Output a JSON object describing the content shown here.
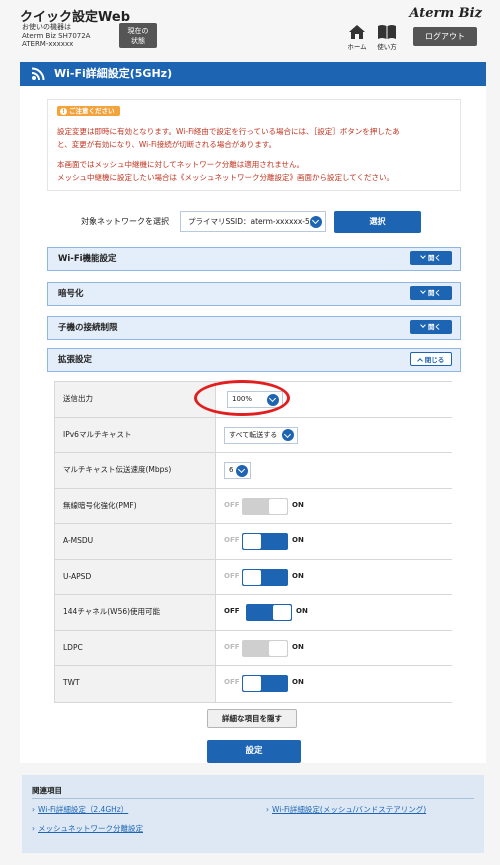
{
  "header": {
    "app_title": "クイック設定Web",
    "device_line1": "お使いの機器は",
    "device_line2": "Aterm Biz SH7072A",
    "device_line3": "ATERM-xxxxxx",
    "status_button_line1": "現在の",
    "status_button_line2": "状態",
    "home_label": "ホーム",
    "help_label": "使い方",
    "logo": "Aterm Biz",
    "logout_label": "ログアウト"
  },
  "page": {
    "title": "Wi-Fi詳細設定(5GHz)"
  },
  "notice": {
    "head": "ご注意ください",
    "line1": "設定変更は即時に有効となります。Wi-Fi経由で設定を行っている場合には、［設定］ボタンを押したあ",
    "line2": "と、変更が有効になり、Wi-Fi接続が切断される場合があります。",
    "line3": "本画面ではメッシュ中継機に対してネットワーク分離は適用されません。",
    "line4": "メッシュ中継機に設定したい場合は《メッシュネットワーク分離設定》画面から設定してください。"
  },
  "network_select": {
    "label": "対象ネットワークを選択",
    "value": "プライマリSSID：aterm-xxxxxx-5p",
    "button": "選択"
  },
  "sections": [
    {
      "title": "Wi-Fi機能設定",
      "button": "開く"
    },
    {
      "title": "暗号化",
      "button": "開く"
    },
    {
      "title": "子機の接続制限",
      "button": "開く"
    },
    {
      "title": "拡張設定",
      "button": "閉じる"
    }
  ],
  "settings": {
    "tx_power": {
      "label": "送信出力",
      "value": "100%"
    },
    "ipv6_multicast": {
      "label": "IPv6マルチキャスト",
      "value": "すべて転送する"
    },
    "multicast_rate": {
      "label": "マルチキャスト伝送速度(Mbps)",
      "value": "6"
    },
    "pmf": {
      "label": "無線暗号化強化(PMF)",
      "off": "OFF",
      "on": "ON",
      "state": "off-disabled"
    },
    "amsdu": {
      "label": "A-MSDU",
      "off": "OFF",
      "on": "ON",
      "state": "on"
    },
    "uapsd": {
      "label": "U-APSD",
      "off": "OFF",
      "on": "ON",
      "state": "on"
    },
    "ch144": {
      "label": "144チャネル(W56)使用可能",
      "off": "OFF",
      "on": "ON",
      "state": "off"
    },
    "ldpc": {
      "label": "LDPC",
      "off": "OFF",
      "on": "ON",
      "state": "off-disabled"
    },
    "twt": {
      "label": "TWT",
      "off": "OFF",
      "on": "ON",
      "state": "on"
    }
  },
  "buttons": {
    "hide_details": "詳細な項目を隠す",
    "apply": "設定"
  },
  "related": {
    "title": "関連項目",
    "link1": "Wi-Fi詳細設定（2.4GHz）",
    "link2": "Wi-Fi詳細設定(メッシュ/バンドステアリング)",
    "link3": "メッシュネットワーク分離設定"
  },
  "colors": {
    "primary": "#1d64b3",
    "notice_text": "#c2331f",
    "highlight_circle": "#e21e1e"
  }
}
